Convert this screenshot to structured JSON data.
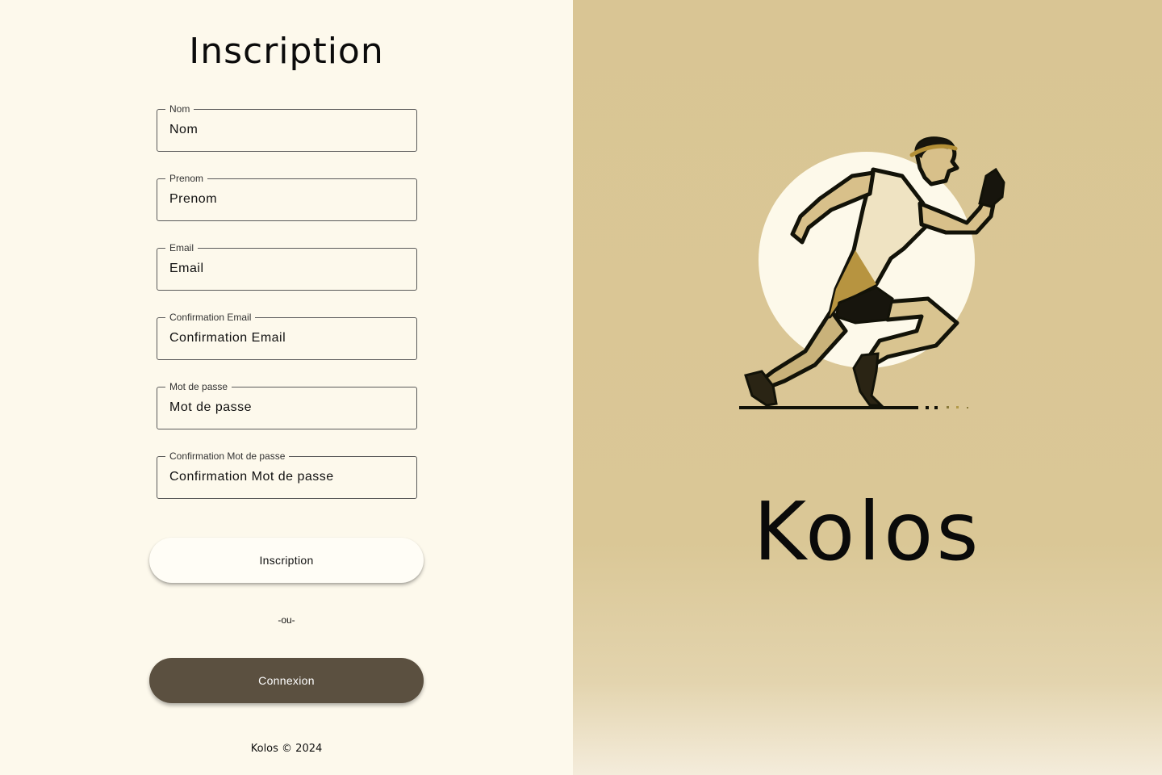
{
  "form": {
    "title": "Inscription",
    "fields": [
      {
        "label": "Nom",
        "placeholder": "Nom"
      },
      {
        "label": "Prenom",
        "placeholder": "Prenom"
      },
      {
        "label": "Email",
        "placeholder": "Email"
      },
      {
        "label": "Confirmation Email",
        "placeholder": "Confirmation Email"
      },
      {
        "label": "Mot de passe",
        "placeholder": "Mot de passe"
      },
      {
        "label": "Confirmation Mot de passe",
        "placeholder": "Confirmation Mot de passe"
      }
    ],
    "submit_label": "Inscription",
    "separator": "-ou-",
    "login_label": "Connexion"
  },
  "footer": {
    "text": "Kolos © 2024"
  },
  "hero": {
    "brand": "Kolos",
    "illustration": "greek-runner-icon"
  },
  "colors": {
    "left_background": "#fdf9ec",
    "right_background": "#d9c594",
    "login_button": "#5b5040"
  }
}
